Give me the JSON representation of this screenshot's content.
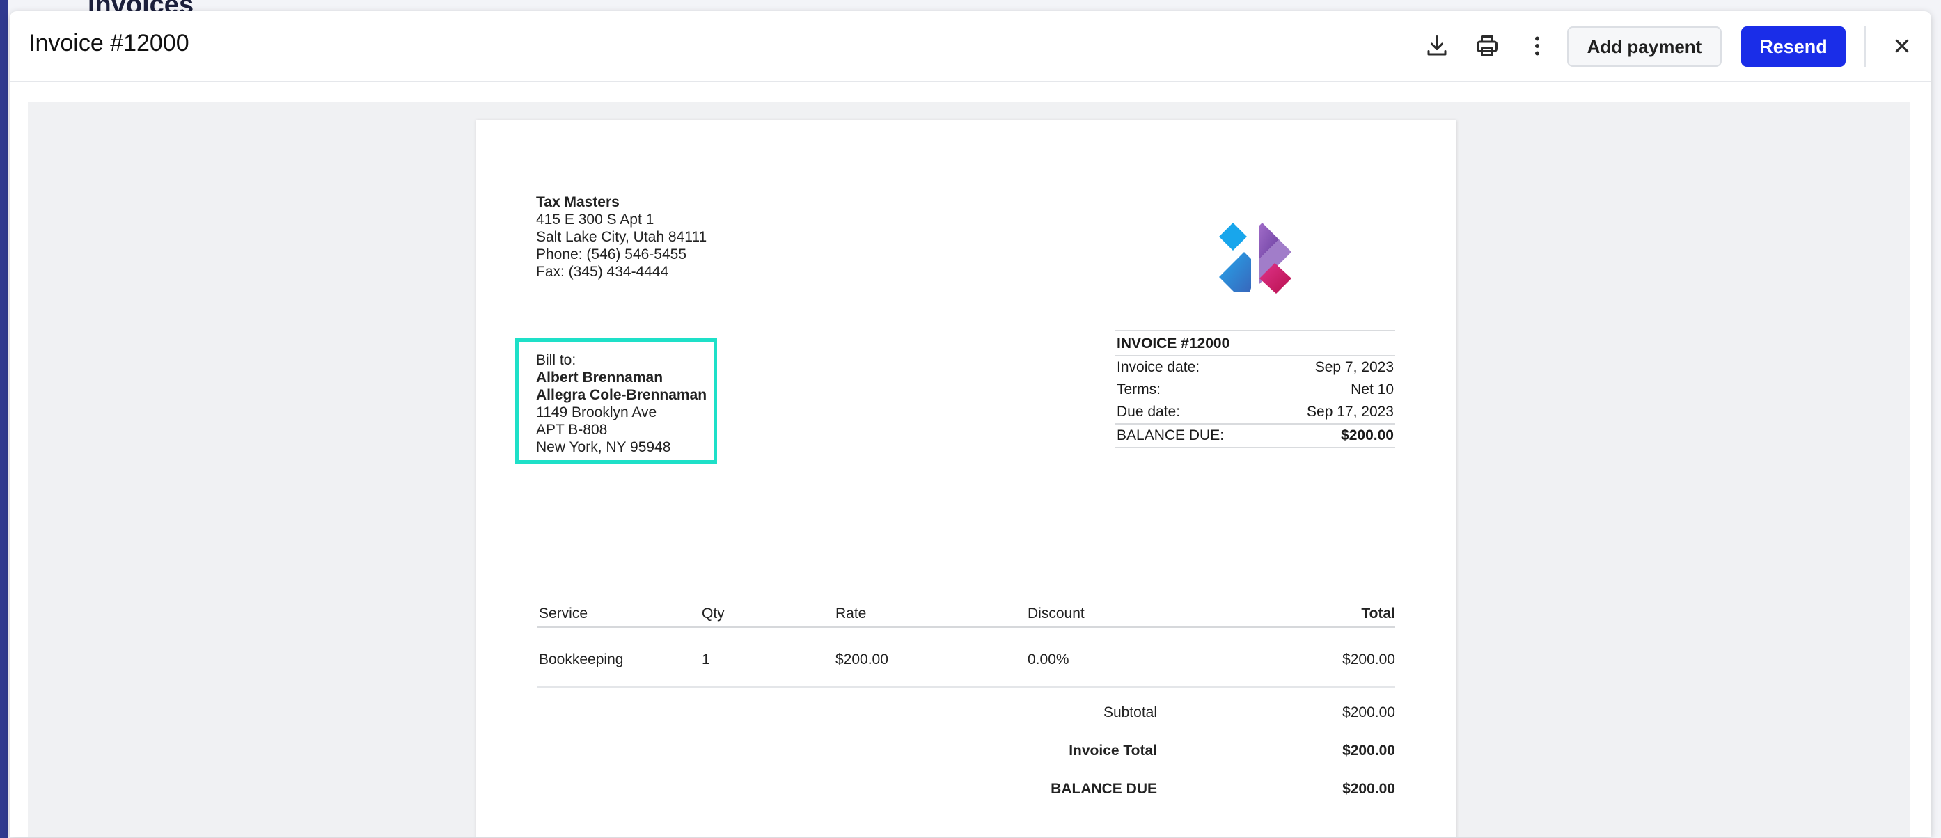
{
  "background": {
    "title": "Invoices"
  },
  "modal": {
    "title": "Invoice #12000",
    "actions": {
      "download_icon": "download-icon",
      "print_icon": "print-icon",
      "more_icon": "more-vertical-icon",
      "add_payment_label": "Add payment",
      "resend_label": "Resend",
      "close_icon": "close-icon"
    },
    "colors": {
      "primary": "#1a2de8",
      "highlight": "#1ee0c8"
    }
  },
  "invoice": {
    "from": {
      "name": "Tax Masters",
      "address1": "415 E 300 S Apt 1",
      "address2": "Salt Lake City, Utah 84111",
      "phone": "Phone: (546) 546-5455",
      "fax": "Fax: (345) 434-4444"
    },
    "bill_to": {
      "label": "Bill to:",
      "name1": "Albert Brennaman",
      "name2": "Allegra Cole-Brennaman",
      "address1": "1149 Brooklyn Ave",
      "address2": "APT B-808",
      "address3": "New York, NY 95948"
    },
    "meta": {
      "title": "INVOICE #12000",
      "invoice_date_label": "Invoice date:",
      "invoice_date": "Sep 7, 2023",
      "terms_label": "Terms:",
      "terms": "Net 10",
      "due_date_label": "Due date:",
      "due_date": "Sep 17, 2023",
      "balance_label": "BALANCE DUE:",
      "balance": "$200.00"
    },
    "items": {
      "headers": {
        "service": "Service",
        "qty": "Qty",
        "rate": "Rate",
        "discount": "Discount",
        "total": "Total"
      },
      "rows": [
        {
          "service": "Bookkeeping",
          "qty": "1",
          "rate": "$200.00",
          "discount": "0.00%",
          "total": "$200.00"
        }
      ]
    },
    "totals": {
      "subtotal_label": "Subtotal",
      "subtotal": "$200.00",
      "invoice_total_label": "Invoice Total",
      "invoice_total": "$200.00",
      "balance_due_label": "BALANCE DUE",
      "balance_due": "$200.00"
    }
  }
}
